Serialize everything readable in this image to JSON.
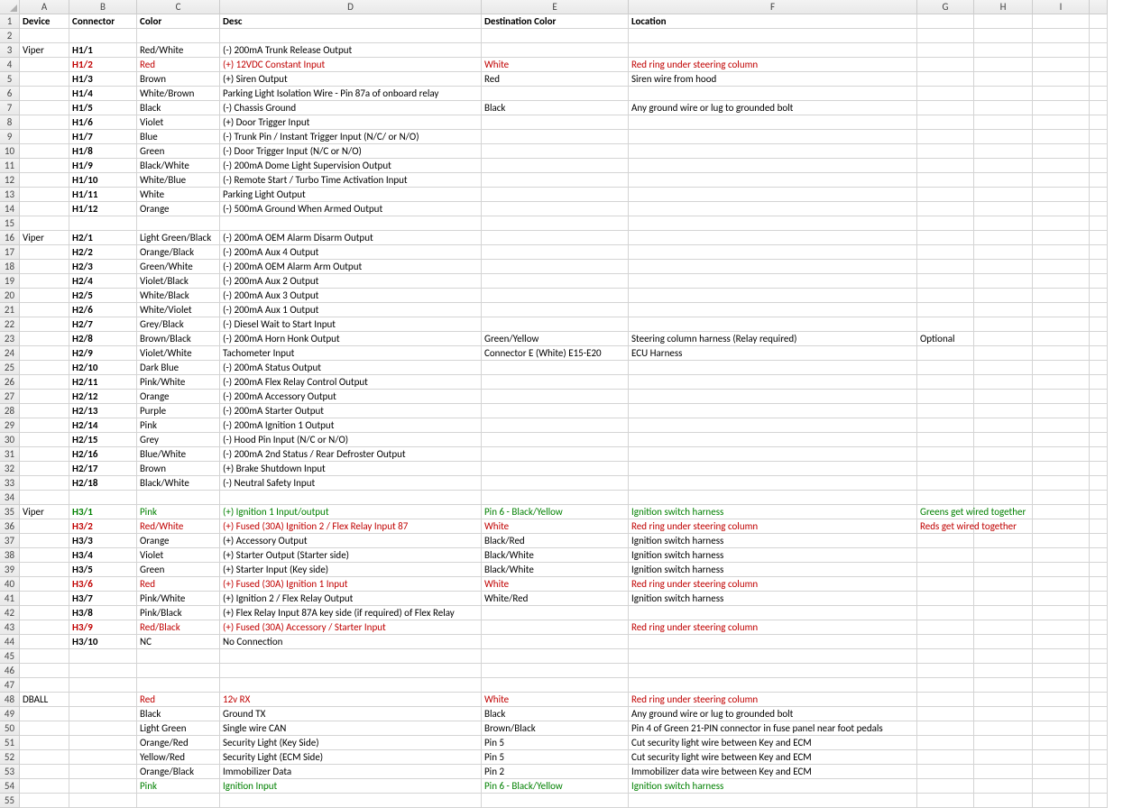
{
  "columns": [
    "A",
    "B",
    "C",
    "D",
    "E",
    "F",
    "G",
    "H",
    "I",
    ""
  ],
  "numRows": 55,
  "headerRow": {
    "A": "Device",
    "B": "Connector",
    "C": "Color",
    "D": "Desc",
    "E": "Destination Color",
    "F": "Location"
  },
  "rows": [
    {
      "n": 1,
      "A": {
        "t": "Device",
        "b": true
      },
      "B": {
        "t": "Connector",
        "b": true
      },
      "C": {
        "t": "Color",
        "b": true
      },
      "D": {
        "t": "Desc",
        "b": true
      },
      "E": {
        "t": "Destination Color",
        "b": true
      },
      "F": {
        "t": "Location",
        "b": true
      }
    },
    {
      "n": 2
    },
    {
      "n": 3,
      "A": {
        "t": "Viper"
      },
      "B": {
        "t": "H1/1",
        "b": true
      },
      "C": {
        "t": "Red/White"
      },
      "D": {
        "t": "(-) 200mA Trunk Release Output"
      }
    },
    {
      "n": 4,
      "B": {
        "t": "H1/2",
        "b": true,
        "c": "red"
      },
      "C": {
        "t": "Red",
        "c": "red"
      },
      "D": {
        "t": "(+) 12VDC Constant Input",
        "c": "red"
      },
      "E": {
        "t": "White",
        "c": "red"
      },
      "F": {
        "t": "Red ring under steering column",
        "c": "red"
      }
    },
    {
      "n": 5,
      "B": {
        "t": "H1/3",
        "b": true
      },
      "C": {
        "t": "Brown"
      },
      "D": {
        "t": "(+) Siren Output"
      },
      "E": {
        "t": "Red"
      },
      "F": {
        "t": "Siren wire from hood"
      }
    },
    {
      "n": 6,
      "B": {
        "t": "H1/4",
        "b": true
      },
      "C": {
        "t": "White/Brown"
      },
      "D": {
        "t": "Parking Light Isolation Wire - Pin 87a of onboard relay"
      }
    },
    {
      "n": 7,
      "B": {
        "t": "H1/5",
        "b": true
      },
      "C": {
        "t": "Black"
      },
      "D": {
        "t": "(-) Chassis Ground"
      },
      "E": {
        "t": "Black"
      },
      "F": {
        "t": "Any ground wire or lug to grounded bolt"
      }
    },
    {
      "n": 8,
      "B": {
        "t": "H1/6",
        "b": true
      },
      "C": {
        "t": "Violet"
      },
      "D": {
        "t": "(+) Door Trigger Input"
      }
    },
    {
      "n": 9,
      "B": {
        "t": "H1/7",
        "b": true
      },
      "C": {
        "t": "Blue"
      },
      "D": {
        "t": "(-) Trunk Pin / Instant Trigger Input (N/C/ or N/O)"
      }
    },
    {
      "n": 10,
      "B": {
        "t": "H1/8",
        "b": true
      },
      "C": {
        "t": "Green"
      },
      "D": {
        "t": "(-) Door Trigger Input (N/C or N/O)"
      }
    },
    {
      "n": 11,
      "B": {
        "t": "H1/9",
        "b": true
      },
      "C": {
        "t": "Black/White"
      },
      "D": {
        "t": "(-) 200mA Dome Light Supervision Output"
      }
    },
    {
      "n": 12,
      "B": {
        "t": "H1/10",
        "b": true
      },
      "C": {
        "t": "White/Blue"
      },
      "D": {
        "t": "(-) Remote Start / Turbo Time Activation Input"
      }
    },
    {
      "n": 13,
      "B": {
        "t": "H1/11",
        "b": true
      },
      "C": {
        "t": "White"
      },
      "D": {
        "t": "Parking Light Output"
      }
    },
    {
      "n": 14,
      "B": {
        "t": "H1/12",
        "b": true
      },
      "C": {
        "t": "Orange"
      },
      "D": {
        "t": "(-) 500mA Ground When Armed Output"
      }
    },
    {
      "n": 15
    },
    {
      "n": 16,
      "A": {
        "t": "Viper"
      },
      "B": {
        "t": "H2/1",
        "b": true
      },
      "C": {
        "t": "Light Green/Black"
      },
      "D": {
        "t": "(-) 200mA OEM Alarm Disarm Output"
      }
    },
    {
      "n": 17,
      "B": {
        "t": "H2/2",
        "b": true
      },
      "C": {
        "t": "Orange/Black"
      },
      "D": {
        "t": "(-) 200mA Aux 4 Output"
      }
    },
    {
      "n": 18,
      "B": {
        "t": "H2/3",
        "b": true
      },
      "C": {
        "t": "Green/White"
      },
      "D": {
        "t": "(-) 200mA OEM Alarm Arm Output"
      }
    },
    {
      "n": 19,
      "B": {
        "t": "H2/4",
        "b": true
      },
      "C": {
        "t": "Violet/Black"
      },
      "D": {
        "t": "(-) 200mA Aux 2 Output"
      }
    },
    {
      "n": 20,
      "B": {
        "t": "H2/5",
        "b": true
      },
      "C": {
        "t": "White/Black"
      },
      "D": {
        "t": "(-) 200mA Aux 3 Output"
      }
    },
    {
      "n": 21,
      "B": {
        "t": "H2/6",
        "b": true
      },
      "C": {
        "t": "White/Violet"
      },
      "D": {
        "t": "(-) 200mA Aux 1 Output"
      }
    },
    {
      "n": 22,
      "B": {
        "t": "H2/7",
        "b": true
      },
      "C": {
        "t": "Grey/Black"
      },
      "D": {
        "t": "(-) Diesel Wait to Start Input"
      }
    },
    {
      "n": 23,
      "B": {
        "t": "H2/8",
        "b": true
      },
      "C": {
        "t": "Brown/Black"
      },
      "D": {
        "t": "(-) 200mA Horn Honk Output"
      },
      "E": {
        "t": "Green/Yellow"
      },
      "F": {
        "t": "Steering column harness (Relay required)"
      },
      "G": {
        "t": "Optional"
      }
    },
    {
      "n": 24,
      "B": {
        "t": "H2/9",
        "b": true
      },
      "C": {
        "t": "Violet/White"
      },
      "D": {
        "t": "Tachometer Input"
      },
      "E": {
        "t": "Connector E (White) E15-E20"
      },
      "F": {
        "t": "ECU Harness"
      }
    },
    {
      "n": 25,
      "B": {
        "t": "H2/10",
        "b": true
      },
      "C": {
        "t": "Dark Blue"
      },
      "D": {
        "t": "(-) 200mA Status Output"
      }
    },
    {
      "n": 26,
      "B": {
        "t": "H2/11",
        "b": true
      },
      "C": {
        "t": "Pink/White"
      },
      "D": {
        "t": "(-) 200mA Flex Relay Control Output"
      }
    },
    {
      "n": 27,
      "B": {
        "t": "H2/12",
        "b": true
      },
      "C": {
        "t": "Orange"
      },
      "D": {
        "t": "(-) 200mA Accessory Output"
      }
    },
    {
      "n": 28,
      "B": {
        "t": "H2/13",
        "b": true
      },
      "C": {
        "t": "Purple"
      },
      "D": {
        "t": "(-) 200mA Starter Output"
      }
    },
    {
      "n": 29,
      "B": {
        "t": "H2/14",
        "b": true
      },
      "C": {
        "t": "Pink"
      },
      "D": {
        "t": "(-) 200mA Ignition 1 Output"
      }
    },
    {
      "n": 30,
      "B": {
        "t": "H2/15",
        "b": true
      },
      "C": {
        "t": "Grey"
      },
      "D": {
        "t": "(-) Hood Pin Input (N/C or N/O)"
      }
    },
    {
      "n": 31,
      "B": {
        "t": "H2/16",
        "b": true
      },
      "C": {
        "t": "Blue/White"
      },
      "D": {
        "t": "(-) 200mA 2nd Status / Rear Defroster Output"
      }
    },
    {
      "n": 32,
      "B": {
        "t": "H2/17",
        "b": true
      },
      "C": {
        "t": "Brown"
      },
      "D": {
        "t": "(+) Brake Shutdown Input"
      }
    },
    {
      "n": 33,
      "B": {
        "t": "H2/18",
        "b": true
      },
      "C": {
        "t": "Black/White"
      },
      "D": {
        "t": "(-) Neutral Safety Input"
      }
    },
    {
      "n": 34
    },
    {
      "n": 35,
      "A": {
        "t": "Viper"
      },
      "B": {
        "t": "H3/1",
        "b": true,
        "c": "green"
      },
      "C": {
        "t": "Pink",
        "c": "green"
      },
      "D": {
        "t": "(+) Ignition 1 Input/output",
        "c": "green"
      },
      "E": {
        "t": "Pin 6 - Black/Yellow",
        "c": "green"
      },
      "F": {
        "t": "Ignition switch harness",
        "c": "green"
      },
      "G": {
        "t": "Greens get wired together",
        "c": "green"
      }
    },
    {
      "n": 36,
      "B": {
        "t": "H3/2",
        "b": true,
        "c": "red"
      },
      "C": {
        "t": "Red/White",
        "c": "red"
      },
      "D": {
        "t": "(+) Fused (30A) Ignition 2 / Flex Relay Input 87",
        "c": "red"
      },
      "E": {
        "t": "White",
        "c": "red"
      },
      "F": {
        "t": "Red ring under steering column",
        "c": "red"
      },
      "G": {
        "t": "Reds get wired together",
        "c": "red"
      }
    },
    {
      "n": 37,
      "B": {
        "t": "H3/3",
        "b": true
      },
      "C": {
        "t": "Orange"
      },
      "D": {
        "t": "(+) Accessory Output"
      },
      "E": {
        "t": "Black/Red"
      },
      "F": {
        "t": "Ignition switch harness"
      }
    },
    {
      "n": 38,
      "B": {
        "t": "H3/4",
        "b": true
      },
      "C": {
        "t": "Violet"
      },
      "D": {
        "t": "(+) Starter Output (Starter side)"
      },
      "E": {
        "t": "Black/White"
      },
      "F": {
        "t": "Ignition switch harness"
      }
    },
    {
      "n": 39,
      "B": {
        "t": "H3/5",
        "b": true
      },
      "C": {
        "t": "Green"
      },
      "D": {
        "t": "(+) Starter Input (Key side)"
      },
      "E": {
        "t": "Black/White"
      },
      "F": {
        "t": "Ignition switch harness"
      }
    },
    {
      "n": 40,
      "B": {
        "t": "H3/6",
        "b": true,
        "c": "red"
      },
      "C": {
        "t": "Red",
        "c": "red"
      },
      "D": {
        "t": "(+) Fused (30A) Ignition 1 Input",
        "c": "red"
      },
      "E": {
        "t": "White",
        "c": "red"
      },
      "F": {
        "t": "Red ring under steering column",
        "c": "red"
      }
    },
    {
      "n": 41,
      "B": {
        "t": "H3/7",
        "b": true
      },
      "C": {
        "t": "Pink/White"
      },
      "D": {
        "t": "(+) Ignition 2 / Flex Relay Output"
      },
      "E": {
        "t": "White/Red"
      },
      "F": {
        "t": "Ignition switch harness"
      }
    },
    {
      "n": 42,
      "B": {
        "t": "H3/8",
        "b": true
      },
      "C": {
        "t": "Pink/Black"
      },
      "D": {
        "t": "(+) Flex Relay Input 87A key side (if required) of Flex Relay"
      }
    },
    {
      "n": 43,
      "B": {
        "t": "H3/9",
        "b": true,
        "c": "red"
      },
      "C": {
        "t": "Red/Black",
        "c": "red"
      },
      "D": {
        "t": "(+) Fused (30A) Accessory / Starter Input",
        "c": "red"
      },
      "F": {
        "t": "Red ring under steering column",
        "c": "red"
      }
    },
    {
      "n": 44,
      "B": {
        "t": "H3/10",
        "b": true
      },
      "C": {
        "t": "NC"
      },
      "D": {
        "t": "No Connection"
      }
    },
    {
      "n": 45
    },
    {
      "n": 46
    },
    {
      "n": 47
    },
    {
      "n": 48,
      "A": {
        "t": "DBALL"
      },
      "C": {
        "t": "Red",
        "c": "red"
      },
      "D": {
        "t": "12v RX",
        "c": "red"
      },
      "E": {
        "t": "White",
        "c": "red"
      },
      "F": {
        "t": "Red ring under steering column",
        "c": "red"
      }
    },
    {
      "n": 49,
      "C": {
        "t": "Black"
      },
      "D": {
        "t": "Ground TX"
      },
      "E": {
        "t": "Black"
      },
      "F": {
        "t": "Any ground wire or lug to grounded bolt"
      }
    },
    {
      "n": 50,
      "C": {
        "t": "Light Green"
      },
      "D": {
        "t": "Single wire CAN"
      },
      "E": {
        "t": "Brown/Black"
      },
      "F": {
        "t": "Pin 4 of Green 21-PIN connector in fuse panel near foot pedals"
      }
    },
    {
      "n": 51,
      "C": {
        "t": "Orange/Red"
      },
      "D": {
        "t": "Security Light (Key Side)"
      },
      "E": {
        "t": "Pin 5"
      },
      "F": {
        "t": "Cut security light wire between Key and ECM"
      }
    },
    {
      "n": 52,
      "C": {
        "t": "Yellow/Red"
      },
      "D": {
        "t": "Security Light (ECM Side)"
      },
      "E": {
        "t": "Pin 5"
      },
      "F": {
        "t": "Cut security light wire between Key and ECM"
      }
    },
    {
      "n": 53,
      "C": {
        "t": "Orange/Black"
      },
      "D": {
        "t": "Immobilizer Data"
      },
      "E": {
        "t": "Pin 2"
      },
      "F": {
        "t": "Immobilizer data wire between Key and ECM"
      }
    },
    {
      "n": 54,
      "C": {
        "t": "Pink",
        "c": "green"
      },
      "D": {
        "t": "Ignition Input",
        "c": "green"
      },
      "E": {
        "t": "Pin 6 - Black/Yellow",
        "c": "green"
      },
      "F": {
        "t": "Ignition switch harness",
        "c": "green"
      }
    },
    {
      "n": 55
    }
  ]
}
